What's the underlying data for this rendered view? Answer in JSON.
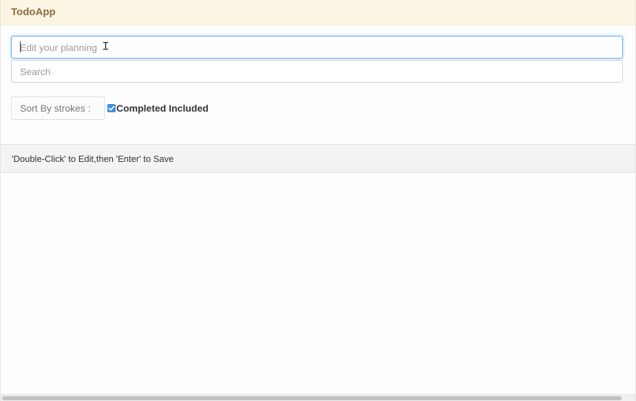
{
  "navbar": {
    "brand": "TodoApp"
  },
  "inputs": {
    "edit_placeholder": "Edit your planning",
    "edit_value": "",
    "search_placeholder": "Search",
    "search_value": ""
  },
  "controls": {
    "sort_label": "Sort By strokes :",
    "completed_label": "Completed Included",
    "completed_checked": true
  },
  "footer": {
    "hint": "'Double-Click' to Edit,then 'Enter' to Save"
  },
  "colors": {
    "navbar_bg": "#fbf5e3",
    "brand": "#8a6d3b",
    "focus_border": "#66afe9",
    "checkbox": "#3b8fe0",
    "footer_bg": "#f3f3f3"
  },
  "icons": {
    "checkbox": "checkmark-icon",
    "cursor": "text-cursor-icon"
  }
}
